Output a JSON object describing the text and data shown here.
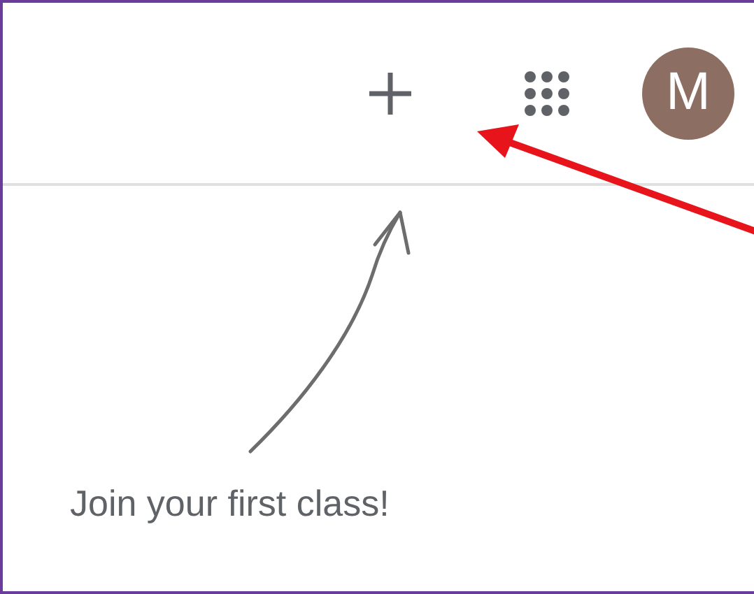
{
  "header": {
    "avatar_letter": "M"
  },
  "empty_state": {
    "message": "Join your first class!"
  }
}
